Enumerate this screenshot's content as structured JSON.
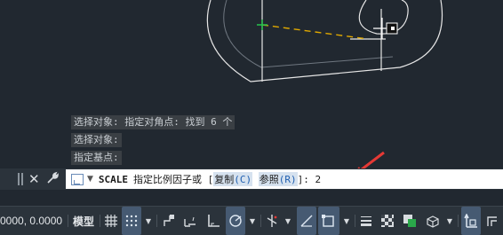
{
  "history": [
    "选择对象: 指定对角点: 找到 6 个",
    "选择对象:",
    "指定基点:"
  ],
  "command": {
    "name": "SCALE",
    "prompt": "指定比例因子或 [",
    "options": [
      {
        "label": "复制",
        "key": "(C)"
      },
      {
        "label": "参照",
        "key": "(R)"
      }
    ],
    "suffix": "]: ",
    "value": "2"
  },
  "status": {
    "coords": "0000, 0.0000",
    "model_label": "模型"
  },
  "colors": {
    "background": "#212830",
    "geometry": "#e6e6e6",
    "dashed_line": "#e0a800",
    "annotation_arrow": "#e53935",
    "base_point": "#27c24c"
  },
  "icons": [
    "grid-icon",
    "snap-icon",
    "dropdown-icon",
    "infer-constraints-icon",
    "dynamic-input-icon",
    "ortho-icon",
    "polar-tracking-icon",
    "object-snap-tracking-icon",
    "object-snap-icon",
    "lineweight-icon",
    "transparency-icon",
    "selection-cycling-icon",
    "3d-osnap-icon",
    "annotation-scale-icon",
    "workspace-icon"
  ]
}
